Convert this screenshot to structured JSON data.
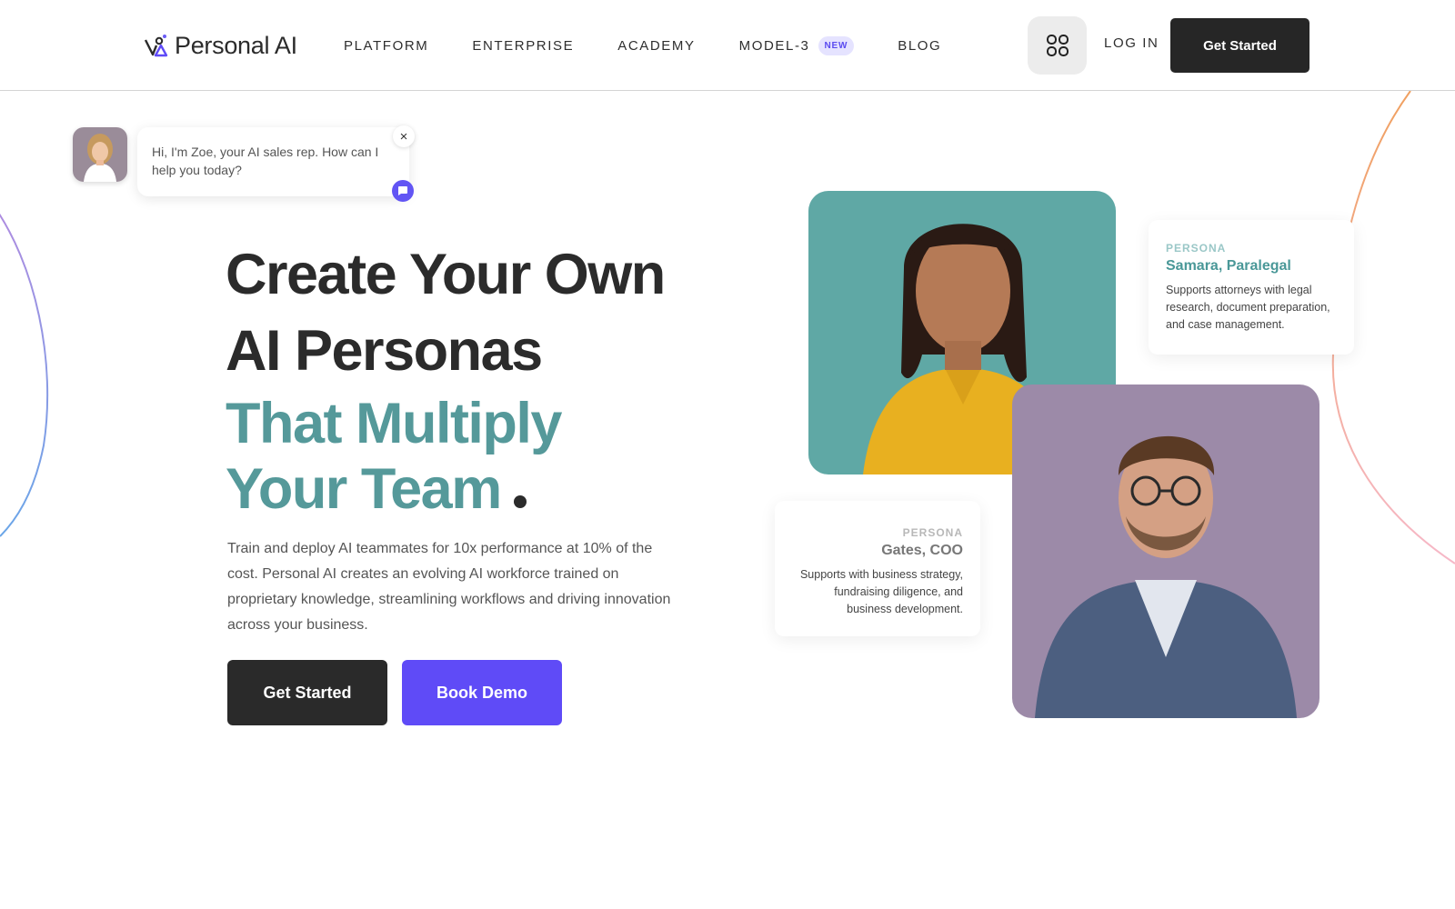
{
  "header": {
    "logo_text": "Personal AI",
    "nav": [
      {
        "label": "PLATFORM"
      },
      {
        "label": "ENTERPRISE"
      },
      {
        "label": "ACADEMY"
      },
      {
        "label": "MODEL-3",
        "badge": "NEW"
      },
      {
        "label": "BLOG"
      }
    ],
    "grid_icon": "apps-grid-icon",
    "login_label": "LOG IN",
    "cta_label": "Get Started"
  },
  "chat": {
    "message": "Hi, I'm Zoe, your AI sales rep. How can I help you today?",
    "close_glyph": "×"
  },
  "hero": {
    "title_line1": "Create Your Own",
    "title_line2": "AI Personas",
    "accent_line1": "That Multiply",
    "accent_line2": "Your Team",
    "description": "Train and deploy AI teammates for 10x performance at 10% of the cost. Personal AI creates an evolving AI workforce trained on proprietary knowledge, streamlining workflows and driving innovation across your business.",
    "primary_cta": "Get Started",
    "secondary_cta": "Book Demo"
  },
  "personas": [
    {
      "label": "PERSONA",
      "name": "Samara, Paralegal",
      "description": "Supports attorneys with legal research, document preparation, and case management."
    },
    {
      "label": "PERSONA",
      "name": "Gates, COO",
      "description": "Supports with business strategy, fundraising diligence, and business development."
    }
  ],
  "colors": {
    "accent_teal": "#55999a",
    "brand_purple": "#5f4bf7",
    "dark": "#2a2a2a"
  }
}
